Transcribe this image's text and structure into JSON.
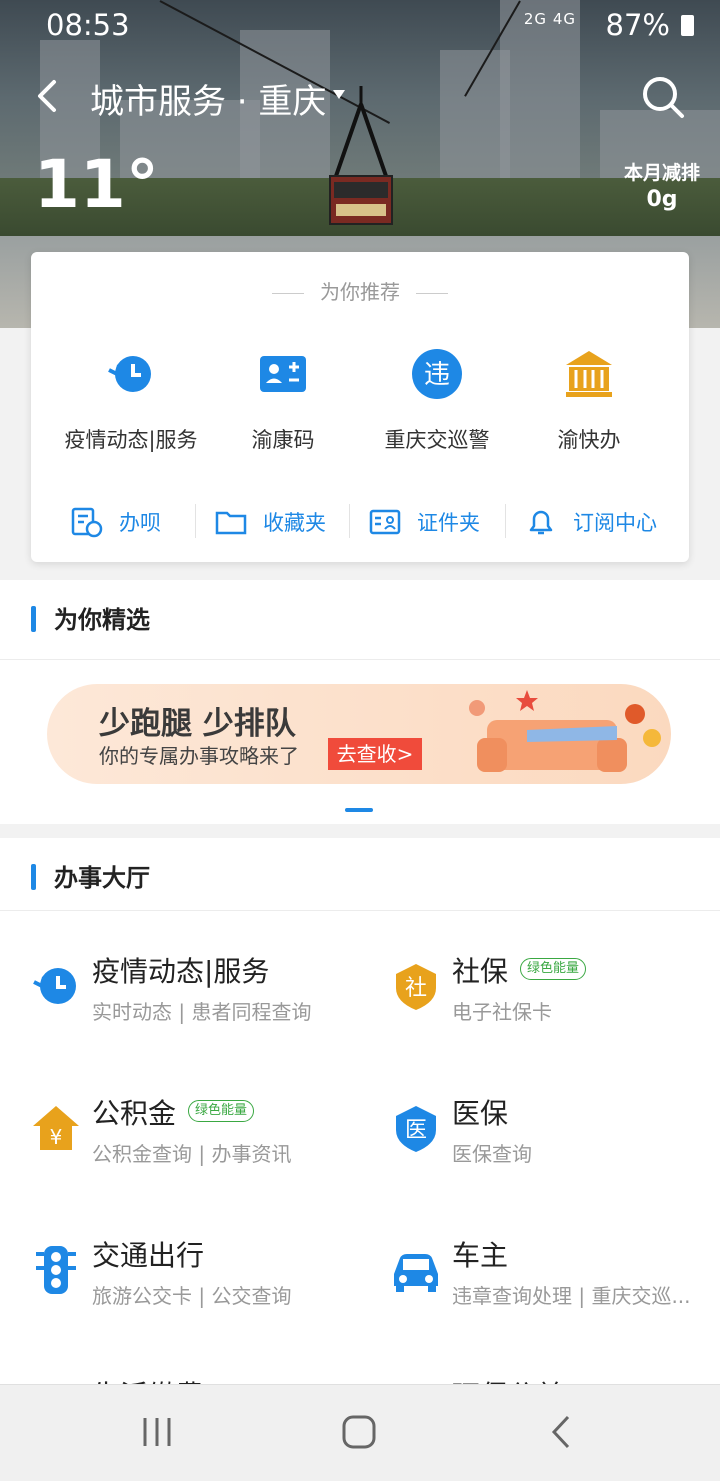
{
  "status": {
    "time": "08:53",
    "signal": "2G 4G",
    "battery": "87%"
  },
  "header": {
    "title": "城市服务 · 重庆",
    "temperature": "11°",
    "emission_label": "本月减排",
    "emission_value": "0g"
  },
  "recommend": {
    "heading": "为你推荐",
    "services": [
      {
        "label": "疫情动态|服务",
        "icon": "clock-refresh-icon"
      },
      {
        "label": "渝康码",
        "icon": "id-card-plus-icon"
      },
      {
        "label": "重庆交巡警",
        "icon": "violation-icon"
      },
      {
        "label": "渝快办",
        "icon": "government-building-icon"
      }
    ],
    "tools": [
      {
        "label": "办呗",
        "icon": "document-clock-icon"
      },
      {
        "label": "收藏夹",
        "icon": "folder-icon"
      },
      {
        "label": "证件夹",
        "icon": "id-card-icon"
      },
      {
        "label": "订阅中心",
        "icon": "bell-icon"
      }
    ]
  },
  "featured": {
    "heading": "为你精选",
    "banner_title": "少跑腿 少排队",
    "banner_sub": "你的专属办事攻略来了",
    "banner_cta": "去查收>"
  },
  "hall": {
    "heading": "办事大厅",
    "items": [
      {
        "name": "疫情动态|服务",
        "sub": "实时动态 | 患者同程查询",
        "badge": "",
        "icon": "clock-refresh-icon"
      },
      {
        "name": "社保",
        "sub": "电子社保卡",
        "badge": "绿色能量",
        "icon": "social-security-shield-icon"
      },
      {
        "name": "公积金",
        "sub": "公积金查询 | 办事资讯",
        "badge": "绿色能量",
        "icon": "housing-fund-house-icon"
      },
      {
        "name": "医保",
        "sub": "医保查询",
        "badge": "",
        "icon": "medical-insurance-shield-icon"
      },
      {
        "name": "交通出行",
        "sub": "旅游公交卡 | 公交查询",
        "badge": "",
        "icon": "traffic-light-icon"
      },
      {
        "name": "车主",
        "sub": "违章查询处理 | 重庆交巡...",
        "badge": "",
        "icon": "car-icon"
      }
    ],
    "cut_left": "生活缴费",
    "cut_right": "环保公益"
  },
  "colors": {
    "accent": "#1e88e5",
    "gold": "#e8a21c",
    "green": "#3aa842",
    "cta": "#f04b3b"
  }
}
